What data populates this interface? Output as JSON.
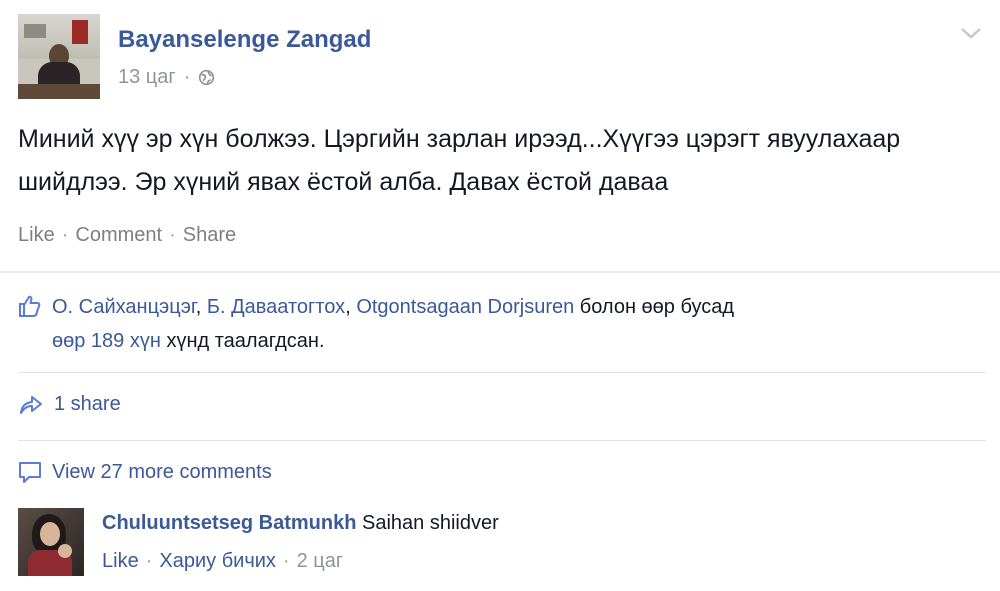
{
  "post": {
    "author": "Bayanselenge Zangad",
    "time": "13 цаг",
    "meta_separator": "·",
    "text": "Миний хүү эр хүн болжээ. Цэргийн зарлан ирээд...Хүүгээ цэрэгт явуулахаар шийдлээ. Эр хүний явах ёстой алба. Давах ёстой даваа",
    "actions": {
      "like": "Like",
      "comment": "Comment",
      "share": "Share",
      "separator": "·"
    }
  },
  "likes": {
    "name1": "О. Сайханцэцэг",
    "comma1": ", ",
    "name2": "Б. Даваатогтох",
    "comma2": ", ",
    "name3": "Otgontsagaan Dorjsuren",
    "suffix": " болон өөр бусад",
    "others": "өөр 189 хүн",
    "others_suffix": " хүнд таалагдсан."
  },
  "shares": {
    "label": "1 share"
  },
  "comments": {
    "view_more": "View 27 more comments",
    "items": [
      {
        "author": "Chuluuntsetseg Batmunkh",
        "text": "Saihan shiidver",
        "like": "Like",
        "reply": "Хариу бичих",
        "time": "2 цаг",
        "separator": "·"
      }
    ]
  },
  "colors": {
    "link": "#3b5998",
    "text": "#141823",
    "muted": "#90949c",
    "divider": "#e9ebee"
  },
  "icons": [
    "globe-icon",
    "chevron-down-icon",
    "like-icon",
    "share-icon",
    "comment-icon"
  ]
}
